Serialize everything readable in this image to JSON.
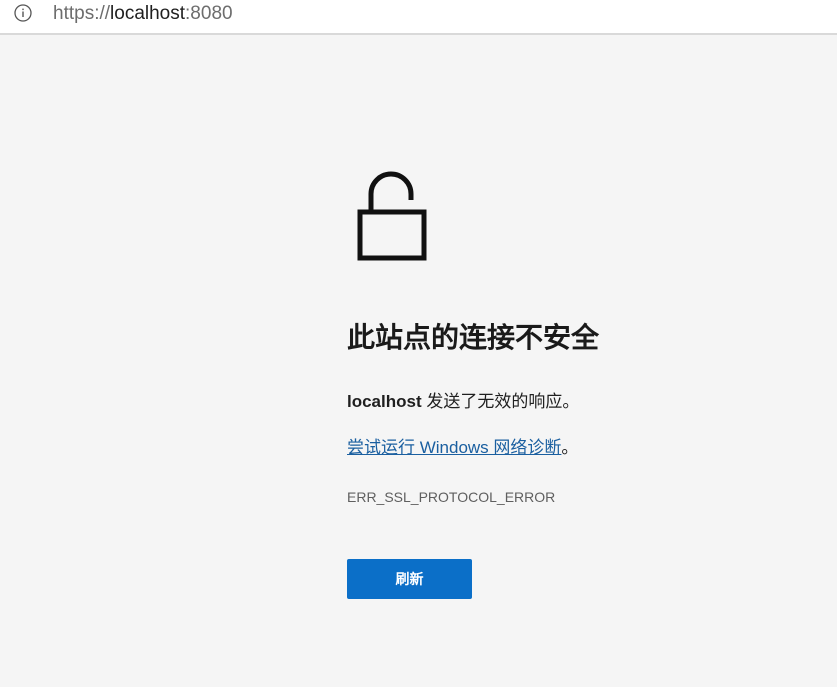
{
  "address_bar": {
    "url_scheme": "https://",
    "url_host": "localhost",
    "url_port": ":8080",
    "info_icon": "info-circle-icon"
  },
  "error_page": {
    "icon": "unlocked-padlock-icon",
    "title": "此站点的连接不安全",
    "description_host": "localhost",
    "description_text": " 发送了无效的响应。",
    "diagnostics_link": "尝试运行 Windows 网络诊断",
    "diagnostics_suffix": "。",
    "error_code": "ERR_SSL_PROTOCOL_ERROR",
    "refresh_button": "刷新"
  },
  "colors": {
    "background": "#f5f5f5",
    "button": "#0b6fc8",
    "link": "#1a5fa0"
  }
}
